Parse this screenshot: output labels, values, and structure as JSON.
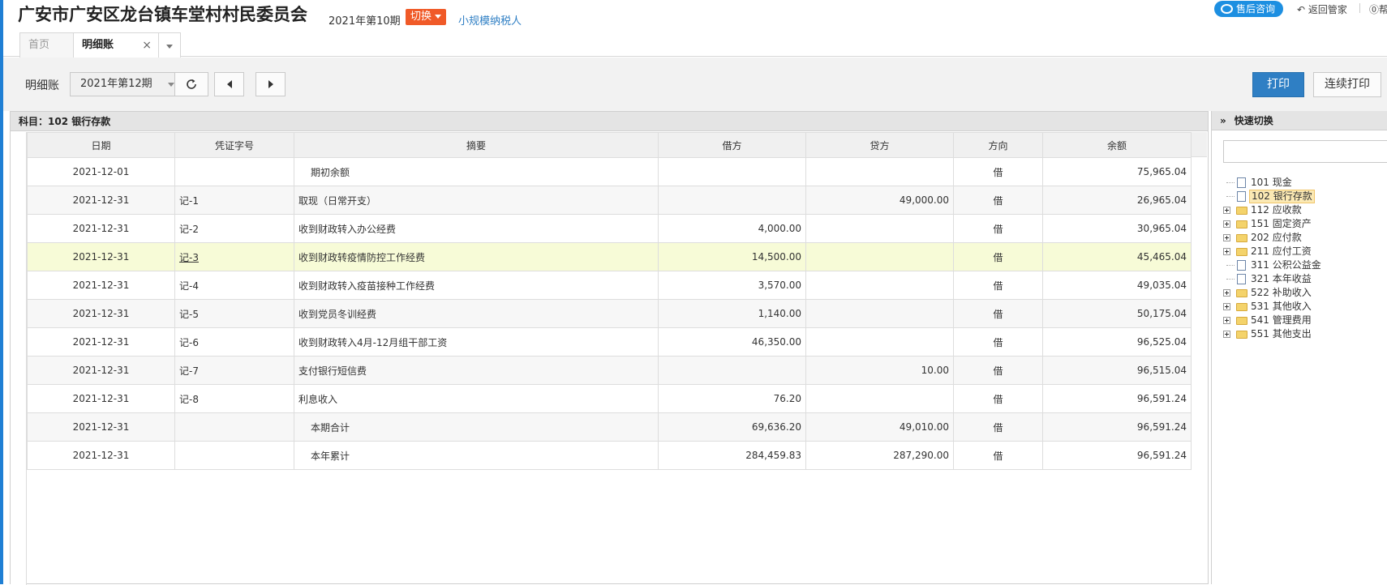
{
  "header": {
    "company": "广安市广安区龙台镇车堂村村民委员会",
    "period": "2021年第10期",
    "switch_label": "切换",
    "taxpayer_type": "小规模纳税人",
    "consult_label": "售后咨询",
    "back_label": "返回管家",
    "help_label": "帮"
  },
  "tabs": {
    "home": "首页",
    "active": "明细账",
    "close": "×"
  },
  "toolbar": {
    "label": "明细账",
    "period_select": "2021年第12期",
    "print": "打印",
    "continuous_print": "连续打印"
  },
  "ledger": {
    "subject": "科目：102 银行存款",
    "columns": [
      "日期",
      "凭证字号",
      "摘要",
      "借方",
      "贷方",
      "方向",
      "余额"
    ],
    "rows": [
      {
        "date": "2021-12-01",
        "voucher": "",
        "summary": "期初余额",
        "debit": "",
        "credit": "",
        "dir": "借",
        "balance": "75,965.04"
      },
      {
        "date": "2021-12-31",
        "voucher": "记-1",
        "summary": "取现（日常开支）",
        "debit": "",
        "credit": "49,000.00",
        "dir": "借",
        "balance": "26,965.04"
      },
      {
        "date": "2021-12-31",
        "voucher": "记-2",
        "summary": "收到财政转入办公经费",
        "debit": "4,000.00",
        "credit": "",
        "dir": "借",
        "balance": "30,965.04"
      },
      {
        "date": "2021-12-31",
        "voucher": "记-3",
        "summary": "收到财政转疫情防控工作经费",
        "debit": "14,500.00",
        "credit": "",
        "dir": "借",
        "balance": "45,465.04"
      },
      {
        "date": "2021-12-31",
        "voucher": "记-4",
        "summary": "收到财政转入疫苗接种工作经费",
        "debit": "3,570.00",
        "credit": "",
        "dir": "借",
        "balance": "49,035.04"
      },
      {
        "date": "2021-12-31",
        "voucher": "记-5",
        "summary": "收到党员冬训经费",
        "debit": "1,140.00",
        "credit": "",
        "dir": "借",
        "balance": "50,175.04"
      },
      {
        "date": "2021-12-31",
        "voucher": "记-6",
        "summary": "收到财政转入4月-12月组干部工资",
        "debit": "46,350.00",
        "credit": "",
        "dir": "借",
        "balance": "96,525.04"
      },
      {
        "date": "2021-12-31",
        "voucher": "记-7",
        "summary": "支付银行短信费",
        "debit": "",
        "credit": "10.00",
        "dir": "借",
        "balance": "96,515.04"
      },
      {
        "date": "2021-12-31",
        "voucher": "记-8",
        "summary": "利息收入",
        "debit": "76.20",
        "credit": "",
        "dir": "借",
        "balance": "96,591.24"
      },
      {
        "date": "2021-12-31",
        "voucher": "",
        "summary": "本期合计",
        "debit": "69,636.20",
        "credit": "49,010.00",
        "dir": "借",
        "balance": "96,591.24"
      },
      {
        "date": "2021-12-31",
        "voucher": "",
        "summary": "本年累计",
        "debit": "284,459.83",
        "credit": "287,290.00",
        "dir": "借",
        "balance": "96,591.24"
      }
    ]
  },
  "quick_switch": {
    "title": "快速切换",
    "search_value": "",
    "tree": [
      {
        "label": "101 现金",
        "type": "file",
        "expandable": false
      },
      {
        "label": "102 银行存款",
        "type": "file",
        "expandable": false,
        "selected": true
      },
      {
        "label": "112 应收款",
        "type": "folder",
        "expandable": true
      },
      {
        "label": "151 固定资产",
        "type": "folder",
        "expandable": true
      },
      {
        "label": "202 应付款",
        "type": "folder",
        "expandable": true
      },
      {
        "label": "211 应付工资",
        "type": "folder",
        "expandable": true
      },
      {
        "label": "311 公积公益金",
        "type": "file",
        "expandable": false
      },
      {
        "label": "321 本年收益",
        "type": "file",
        "expandable": false
      },
      {
        "label": "522 补助收入",
        "type": "folder",
        "expandable": true
      },
      {
        "label": "531 其他收入",
        "type": "folder",
        "expandable": true
      },
      {
        "label": "541 管理费用",
        "type": "folder",
        "expandable": true
      },
      {
        "label": "551 其他支出",
        "type": "folder",
        "expandable": true
      }
    ]
  },
  "colors": {
    "accent": "#2f7fc4",
    "switch": "#f05a28",
    "highlight_row": "#f7fbd7"
  }
}
